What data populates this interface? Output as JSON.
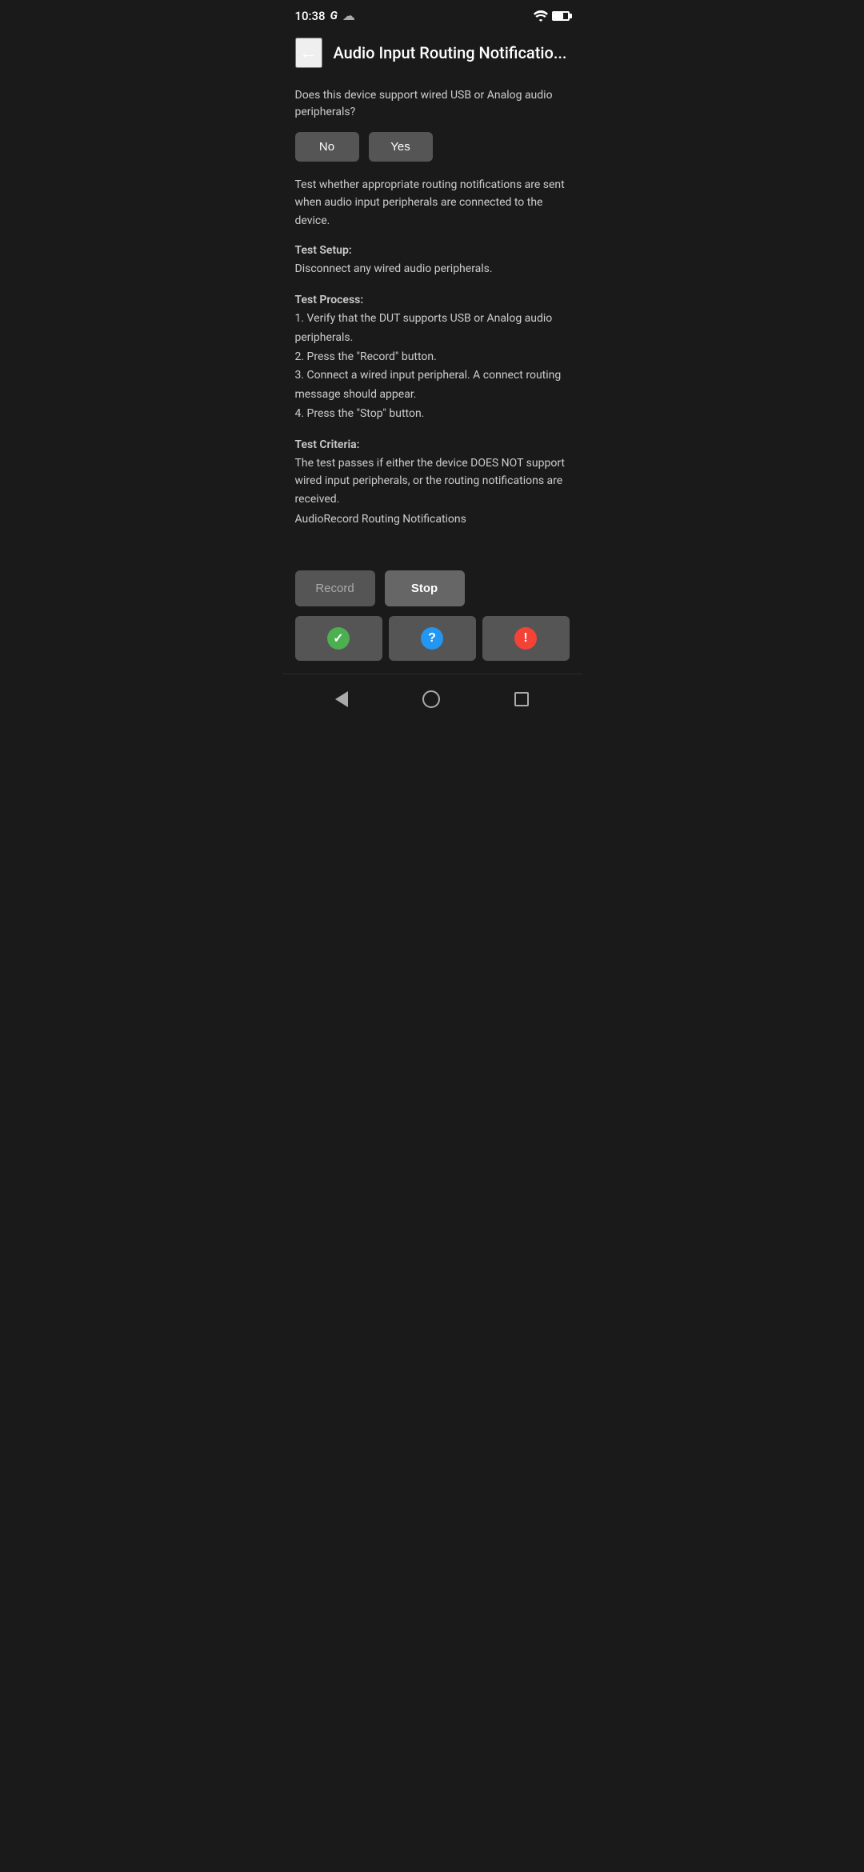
{
  "statusBar": {
    "time": "10:38",
    "google": "G",
    "cloud": "☁"
  },
  "header": {
    "title": "Audio Input Routing Notificatio...",
    "backLabel": "←"
  },
  "content": {
    "question": "Does this device support wired USB or Analog audio peripherals?",
    "noLabel": "No",
    "yesLabel": "Yes",
    "description": "Test whether appropriate routing notifications are sent when audio input peripherals are connected to the device.",
    "testSetupHeader": "Test Setup:",
    "testSetupBody": "Disconnect any wired audio peripherals.",
    "testProcessHeader": "Test Process:",
    "testProcessBody": "1. Verify that the DUT supports USB or Analog audio peripherals.\n2. Press the \"Record\" button.\n3. Connect a wired input peripheral. A connect routing message should appear.\n4. Press the \"Stop\" button.",
    "testCriteriaHeader": "Test Criteria:",
    "testCriteriaBody": "The test passes if either the device DOES NOT support wired input peripherals, or the routing notifications are received.",
    "testCriteriaName": "AudioRecord Routing Notifications"
  },
  "actions": {
    "recordLabel": "Record",
    "stopLabel": "Stop"
  },
  "results": {
    "passIcon": "✓",
    "infoIcon": "?",
    "failIcon": "!"
  },
  "bottomNav": {
    "backLabel": "back",
    "homeLabel": "home",
    "recentLabel": "recent"
  }
}
